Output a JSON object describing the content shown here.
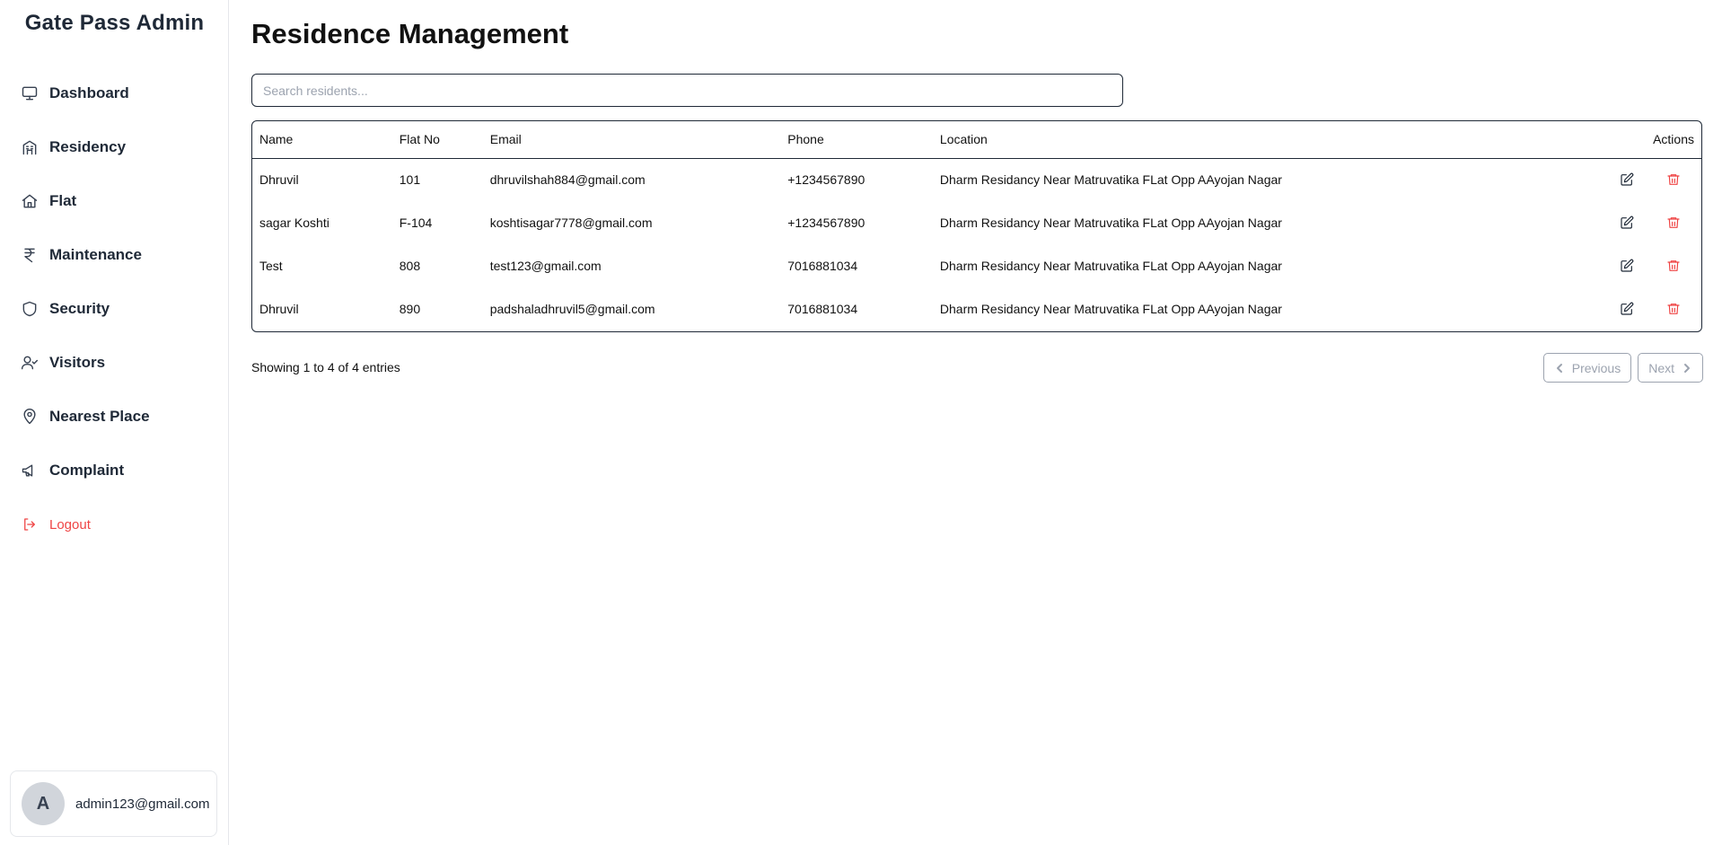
{
  "sidebar": {
    "brand": "Gate Pass Admin",
    "items": [
      {
        "label": "Dashboard",
        "icon": "monitor-icon"
      },
      {
        "label": "Residency",
        "icon": "building-icon"
      },
      {
        "label": "Flat",
        "icon": "home-icon"
      },
      {
        "label": "Maintenance",
        "icon": "rupee-icon"
      },
      {
        "label": "Security",
        "icon": "shield-icon"
      },
      {
        "label": "Visitors",
        "icon": "user-check-icon"
      },
      {
        "label": "Nearest Place",
        "icon": "map-pin-icon"
      },
      {
        "label": "Complaint",
        "icon": "megaphone-icon"
      }
    ],
    "logout_label": "Logout",
    "user": {
      "avatar_initial": "A",
      "email": "admin123@gmail.com"
    }
  },
  "main": {
    "title": "Residence Management",
    "search": {
      "placeholder": "Search residents...",
      "value": ""
    },
    "table": {
      "headers": {
        "name": "Name",
        "flat": "Flat No",
        "email": "Email",
        "phone": "Phone",
        "location": "Location",
        "actions": "Actions"
      },
      "rows": [
        {
          "name": "Dhruvil",
          "flat": "101",
          "email": "dhruvilshah884@gmail.com",
          "phone": "+1234567890",
          "location": "Dharm Residancy Near Matruvatika FLat Opp AAyojan Nagar"
        },
        {
          "name": "sagar Koshti",
          "flat": "F-104",
          "email": "koshtisagar7778@gmail.com",
          "phone": "+1234567890",
          "location": "Dharm Residancy Near Matruvatika FLat Opp AAyojan Nagar"
        },
        {
          "name": "Test",
          "flat": "808",
          "email": "test123@gmail.com",
          "phone": "7016881034",
          "location": "Dharm Residancy Near Matruvatika FLat Opp AAyojan Nagar"
        },
        {
          "name": "Dhruvil",
          "flat": "890",
          "email": "padshaladhruvil5@gmail.com",
          "phone": "7016881034",
          "location": "Dharm Residancy Near Matruvatika FLat Opp AAyojan Nagar"
        }
      ]
    },
    "entries_text": "Showing 1 to 4 of 4 entries",
    "pagination": {
      "previous": "Previous",
      "next": "Next"
    }
  },
  "colors": {
    "danger": "#ef4444",
    "text": "#1f2937",
    "border": "#1f2937",
    "muted": "#9ca3af"
  }
}
